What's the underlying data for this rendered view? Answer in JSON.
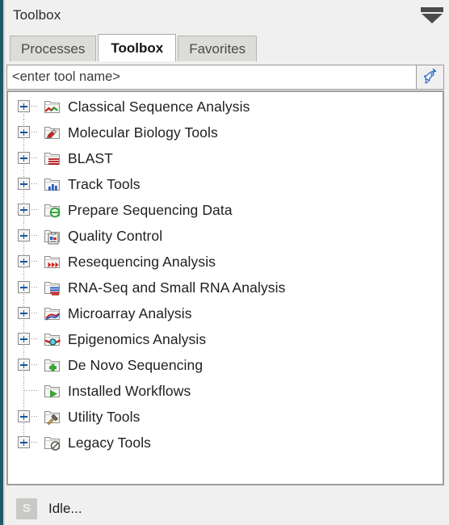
{
  "window": {
    "title": "Toolbox",
    "collapse_icon": "collapse-triangle-icon"
  },
  "tabs": [
    {
      "label": "Processes",
      "active": false
    },
    {
      "label": "Toolbox",
      "active": true
    },
    {
      "label": "Favorites",
      "active": false
    }
  ],
  "search": {
    "value": "",
    "placeholder": "<enter tool name>",
    "button_icon": "rocket-icon"
  },
  "tree": {
    "items": [
      {
        "label": "Classical Sequence Analysis",
        "expandable": true,
        "icon": "folder-sequence-icon"
      },
      {
        "label": "Molecular Biology Tools",
        "expandable": true,
        "icon": "folder-pen-icon"
      },
      {
        "label": "BLAST",
        "expandable": true,
        "icon": "folder-blast-icon"
      },
      {
        "label": "Track Tools",
        "expandable": true,
        "icon": "folder-barchart-icon"
      },
      {
        "label": "Prepare Sequencing Data",
        "expandable": true,
        "icon": "folder-green-circle-icon"
      },
      {
        "label": "Quality Control",
        "expandable": true,
        "icon": "folder-clipboard-icon"
      },
      {
        "label": "Resequencing Analysis",
        "expandable": true,
        "icon": "folder-red-arrows-icon"
      },
      {
        "label": "RNA-Seq and Small RNA Analysis",
        "expandable": true,
        "icon": "folder-rnaseq-icon"
      },
      {
        "label": "Microarray Analysis",
        "expandable": true,
        "icon": "folder-curves-icon"
      },
      {
        "label": "Epigenomics Analysis",
        "expandable": true,
        "icon": "folder-epigenomics-icon"
      },
      {
        "label": "De Novo Sequencing",
        "expandable": true,
        "icon": "folder-green-plus-icon"
      },
      {
        "label": "Installed Workflows",
        "expandable": false,
        "icon": "folder-play-icon"
      },
      {
        "label": "Utility Tools",
        "expandable": true,
        "icon": "folder-hammer-icon"
      },
      {
        "label": "Legacy Tools",
        "expandable": true,
        "icon": "folder-clock-icon"
      }
    ]
  },
  "status": {
    "badge": "S",
    "text": "Idle..."
  },
  "colors": {
    "accent": "#1f5a66",
    "expander_plus": "#15569b",
    "rocket": "#2d6fc4",
    "panel_bg": "#f0f0f0",
    "list_bg": "#ffffff"
  }
}
